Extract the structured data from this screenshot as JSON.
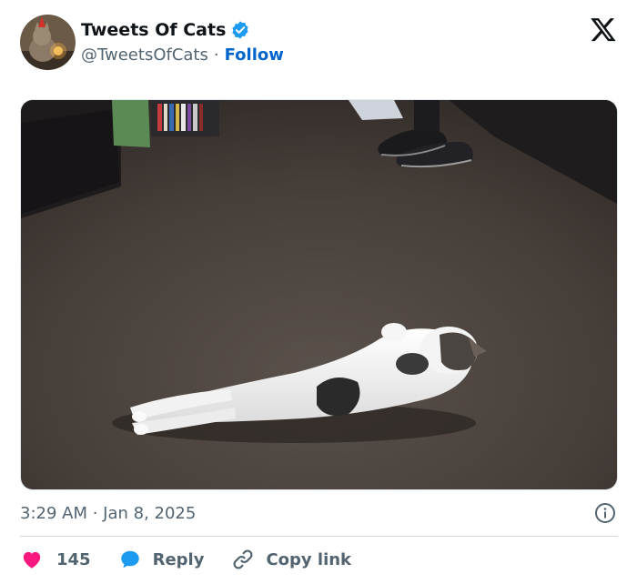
{
  "author": {
    "display_name": "Tweets Of Cats",
    "handle": "@TweetsOfCats",
    "separator": "·",
    "follow_label": "Follow",
    "verified": true
  },
  "platform": {
    "logo_icon": "x-logo-icon"
  },
  "tweet": {
    "timestamp": "3:29 AM · Jan 8, 2025",
    "media_alt_icon": "photo-cat-lying-on-carpet"
  },
  "actions": {
    "like_count": "145",
    "reply_label": "Reply",
    "copy_link_label": "Copy link"
  },
  "colors": {
    "accent": "#1d9bf0",
    "follow": "#0066cc",
    "like": "#f91880",
    "muted": "#536471",
    "carpet": "#4a423d"
  }
}
